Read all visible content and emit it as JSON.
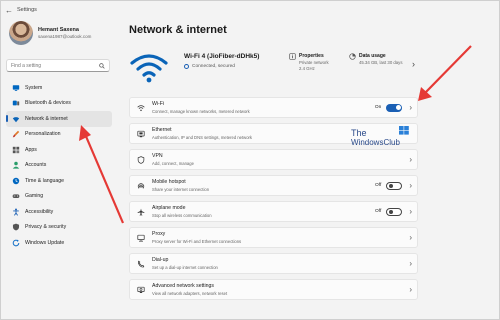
{
  "window": {
    "title": "Settings"
  },
  "profile": {
    "name": "Hemant Saxena",
    "email": "saxena1987@outlook.com"
  },
  "search": {
    "placeholder": "Find a setting"
  },
  "sidebar": {
    "items": [
      {
        "label": "System",
        "icon": "monitor-icon",
        "color": "#0067c0",
        "active": false
      },
      {
        "label": "Bluetooth & devices",
        "icon": "bluetooth-icon",
        "color": "#0067c0",
        "active": false
      },
      {
        "label": "Network & internet",
        "icon": "wifi-icon",
        "color": "#0a64b8",
        "active": true
      },
      {
        "label": "Personalization",
        "icon": "brush-icon",
        "color": "#e07a2a",
        "active": false
      },
      {
        "label": "Apps",
        "icon": "apps-icon",
        "color": "#555555",
        "active": false
      },
      {
        "label": "Accounts",
        "icon": "person-icon",
        "color": "#2a9d6a",
        "active": false
      },
      {
        "label": "Time & language",
        "icon": "clock-globe-icon",
        "color": "#0067c0",
        "active": false
      },
      {
        "label": "Gaming",
        "icon": "gamepad-icon",
        "color": "#555555",
        "active": false
      },
      {
        "label": "Accessibility",
        "icon": "accessibility-icon",
        "color": "#1a5fb4",
        "active": false
      },
      {
        "label": "Privacy & security",
        "icon": "shield-icon",
        "color": "#555555",
        "active": false
      },
      {
        "label": "Windows Update",
        "icon": "update-icon",
        "color": "#1a73c8",
        "active": false
      }
    ]
  },
  "main": {
    "title": "Network & internet",
    "connection": {
      "name": "Wi-Fi 4 (JioFiber-dDHk5)",
      "status": "Connected, secured"
    },
    "properties": {
      "title": "Properties",
      "line1": "Private network",
      "line2": "2.4 GHz"
    },
    "data_usage": {
      "title": "Data usage",
      "line1": "45.34 GB, last 30 days"
    },
    "cards": [
      {
        "title": "Wi-Fi",
        "subtitle": "Connect, manage known networks, metered network",
        "icon": "wifi-icon",
        "state": "On",
        "toggle": "on"
      },
      {
        "title": "Ethernet",
        "subtitle": "Authentication, IP and DNS settings, metered network",
        "icon": "ethernet-icon",
        "state": "",
        "toggle": "none"
      },
      {
        "title": "VPN",
        "subtitle": "Add, connect, manage",
        "icon": "vpn-shield-icon",
        "state": "",
        "toggle": "none"
      },
      {
        "title": "Mobile hotspot",
        "subtitle": "Share your internet connection",
        "icon": "hotspot-icon",
        "state": "Off",
        "toggle": "off"
      },
      {
        "title": "Airplane mode",
        "subtitle": "Stop all wireless communication",
        "icon": "airplane-icon",
        "state": "Off",
        "toggle": "off"
      },
      {
        "title": "Proxy",
        "subtitle": "Proxy server for Wi-Fi and Ethernet connections",
        "icon": "proxy-icon",
        "state": "",
        "toggle": "none"
      },
      {
        "title": "Dial-up",
        "subtitle": "Set up a dial-up internet connection",
        "icon": "dialup-icon",
        "state": "",
        "toggle": "none"
      },
      {
        "title": "Advanced network settings",
        "subtitle": "View all network adapters, network reset",
        "icon": "advanced-network-icon",
        "state": "",
        "toggle": "none"
      }
    ]
  },
  "watermark": {
    "line1": "The",
    "line2": "WindowsClub"
  },
  "colors": {
    "accent": "#1a5fb4",
    "arrow": "#e53935"
  }
}
